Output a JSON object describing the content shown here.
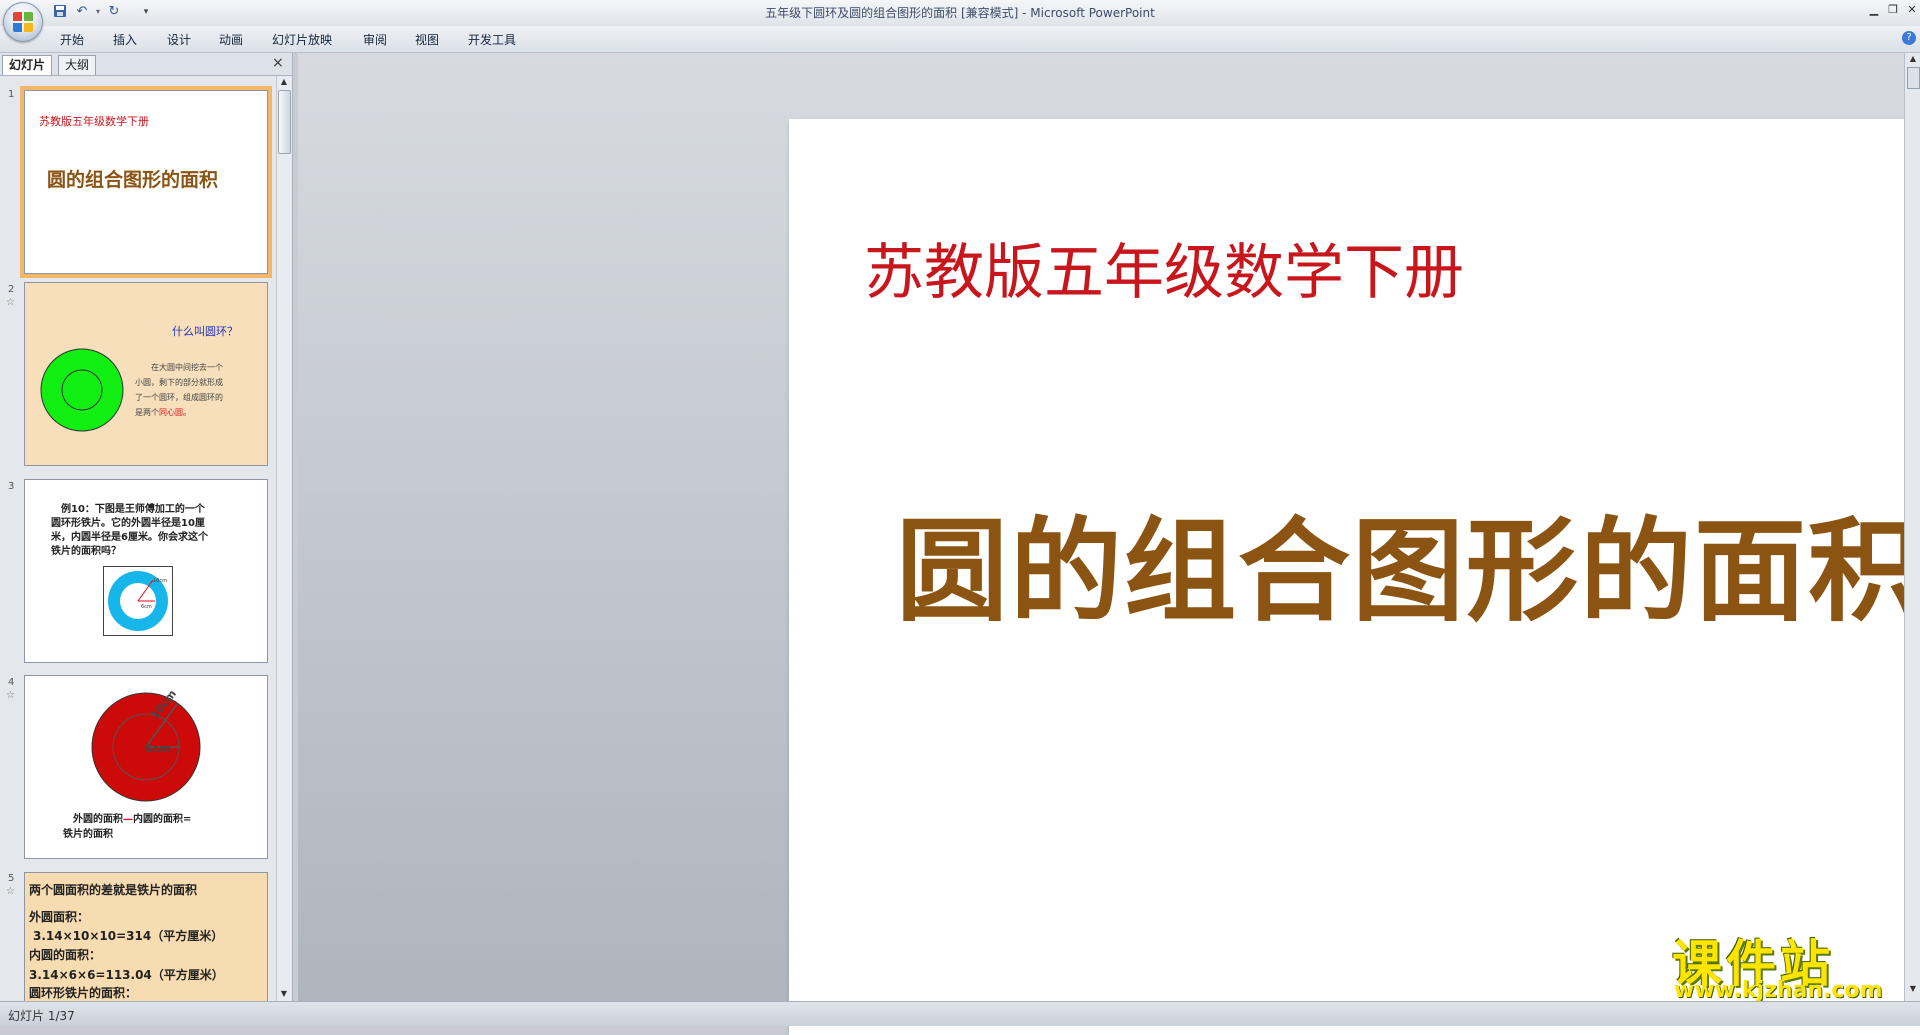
{
  "window": {
    "title": "五年级下圆环及圆的组合图形的面积 [兼容模式] - Microsoft PowerPoint"
  },
  "quick_access": {
    "icons": [
      "save-icon",
      "undo-icon",
      "redo-icon",
      "customize-dropdown-icon"
    ]
  },
  "ribbon": {
    "tabs": [
      "开始",
      "插入",
      "设计",
      "动画",
      "幻灯片放映",
      "审阅",
      "视图",
      "开发工具"
    ]
  },
  "left_panel": {
    "tabs": [
      "幻灯片",
      "大纲"
    ],
    "close_glyph": "×",
    "slides": [
      {
        "number": "1",
        "subtitle": "苏教版五年级数学下册",
        "title": "圆的组合图形的面积"
      },
      {
        "number": "2",
        "heading": "什么叫圆环？",
        "line1": "在大圆中间挖去一个",
        "line2": "小圆，剩下的部分就形成",
        "line3": "了一个圆环，组成圆环的",
        "line4a": "是两个",
        "line4b": "同心圆",
        "line4c": "。"
      },
      {
        "number": "3",
        "line1": "例10：下图是王师傅加工的一个",
        "line2": "圆环形铁片。它的外圆半径是10厘",
        "line3": "米，内圆半径是6厘米。你会求这个",
        "line4": "铁片的面积吗？",
        "label_r": "10cm",
        "label_r2": "6cm"
      },
      {
        "number": "4",
        "label_outer": "10cm",
        "label_inner": "6cm",
        "caption_a": "外圆的面积",
        "caption_minus": "—",
        "caption_b": "内圆的面积",
        "caption_eq": "=",
        "caption_c": "铁片的面积"
      },
      {
        "number": "5",
        "line1": "两个圆面积的差就是铁片的面积",
        "line2": "外圆面积：",
        "line3": "3.14×10×10=314（平方厘米）",
        "line4": "内圆的面积：",
        "line5": "3.14×6×6=113.04（平方厘米）",
        "line6": "圆环形铁片的面积："
      }
    ]
  },
  "slide": {
    "subtitle": "苏教版五年级数学下册",
    "title": "圆的组合图形的面积",
    "subtitle_color": "#c8161d",
    "title_color": "#8b5413"
  },
  "status": {
    "text": "幻灯片 1/37"
  },
  "watermark": {
    "main": "课件站",
    "url": "www.kjzhan.com"
  }
}
